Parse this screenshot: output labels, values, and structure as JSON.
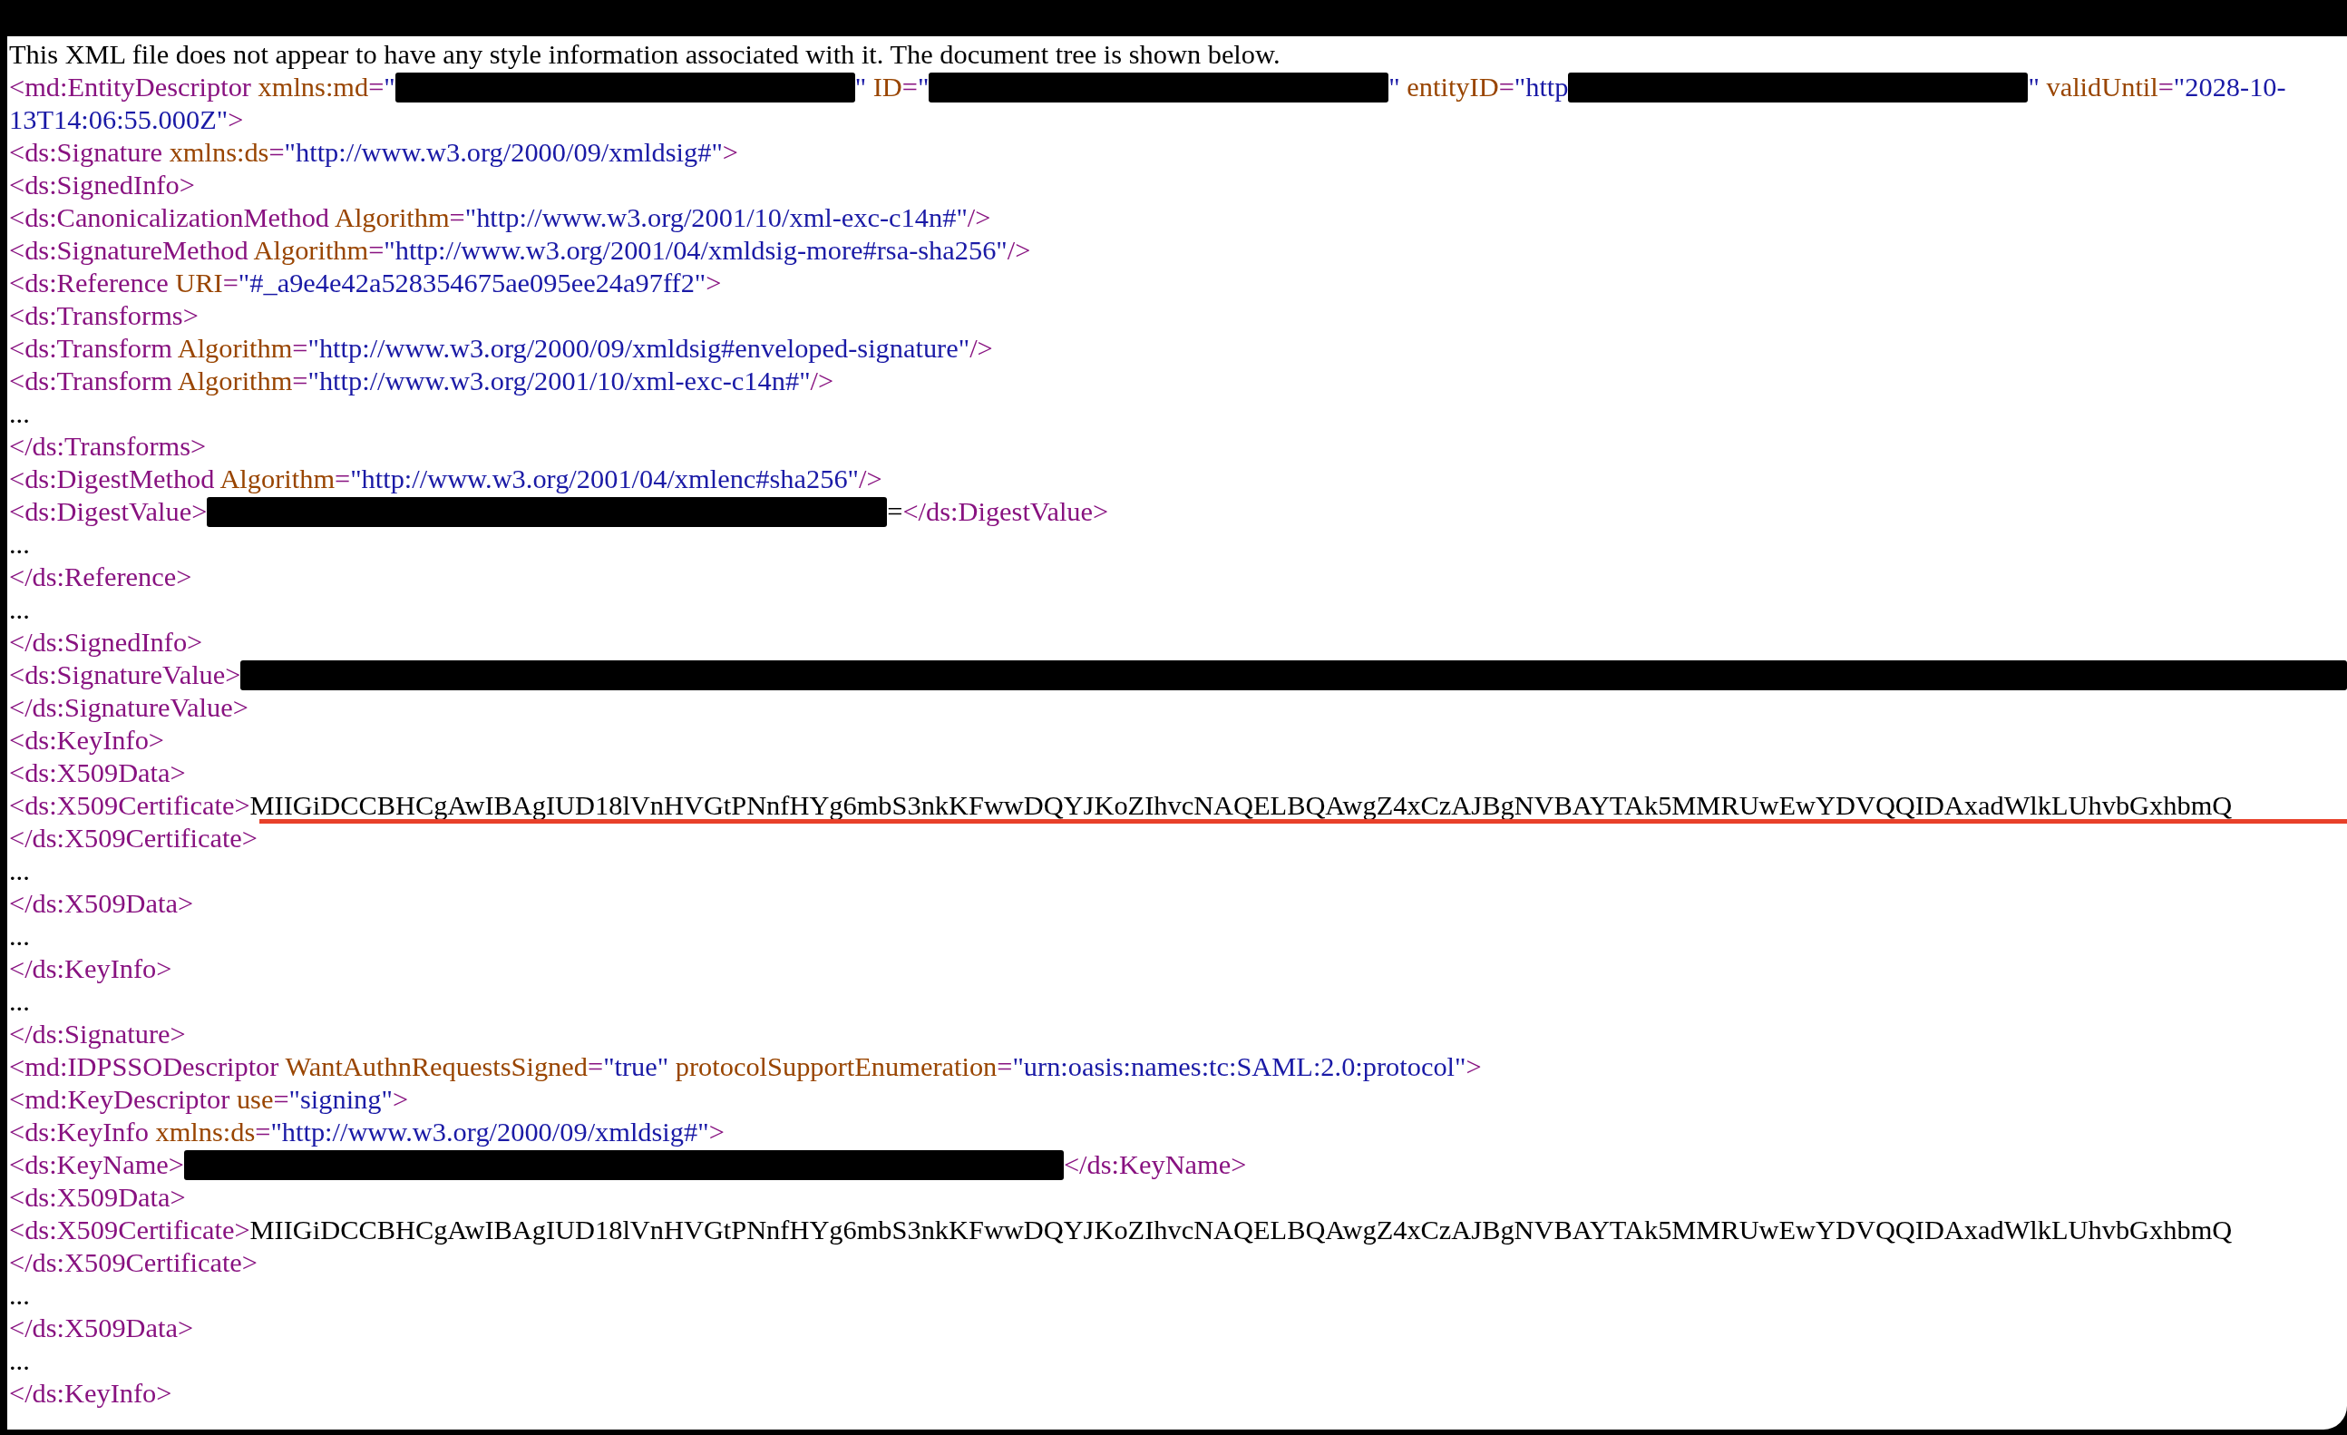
{
  "lines": [
    {
      "underlined": false,
      "segments": [
        {
          "kind": "code",
          "tokens": [
            {
              "kind": "text",
              "text": "This XML file does not appear to have any style information associated with it. The document tree is shown below."
            }
          ]
        }
      ]
    },
    {
      "underlined": false,
      "segments": [
        {
          "kind": "code",
          "tokens": [
            {
              "kind": "tag",
              "text": "<md:EntityDescriptor"
            },
            {
              "kind": "attr",
              "text": " xmlns:md"
            },
            {
              "kind": "tag",
              "text": "="
            },
            {
              "kind": "value",
              "text": "\""
            }
          ]
        },
        {
          "kind": "redacted"
        },
        {
          "kind": "code",
          "tokens": [
            {
              "kind": "value",
              "text": "\""
            },
            {
              "kind": "attr",
              "text": " ID"
            },
            {
              "kind": "tag",
              "text": "="
            },
            {
              "kind": "value",
              "text": "\""
            }
          ]
        },
        {
          "kind": "redacted"
        },
        {
          "kind": "code",
          "tokens": [
            {
              "kind": "value",
              "text": "\""
            },
            {
              "kind": "attr",
              "text": " entityID"
            },
            {
              "kind": "tag",
              "text": "="
            },
            {
              "kind": "value",
              "text": "\"http"
            }
          ]
        },
        {
          "kind": "redacted"
        },
        {
          "kind": "code",
          "tokens": [
            {
              "kind": "value",
              "text": "\""
            },
            {
              "kind": "attr",
              "text": " validUntil"
            },
            {
              "kind": "tag",
              "text": "="
            },
            {
              "kind": "value",
              "text": "\"2028-10-"
            }
          ]
        }
      ]
    },
    {
      "underlined": false,
      "segments": [
        {
          "kind": "code",
          "tokens": [
            {
              "kind": "value",
              "text": "13T14:06:55.000Z\""
            },
            {
              "kind": "tag",
              "text": ">"
            }
          ]
        }
      ]
    },
    {
      "underlined": false,
      "segments": [
        {
          "kind": "code",
          "tokens": [
            {
              "kind": "tag",
              "text": "<ds:Signature"
            },
            {
              "kind": "attr",
              "text": " xmlns:ds"
            },
            {
              "kind": "tag",
              "text": "="
            },
            {
              "kind": "value",
              "text": "\"http://www.w3.org/2000/09/xmldsig#\""
            },
            {
              "kind": "tag",
              "text": ">"
            }
          ]
        }
      ]
    },
    {
      "underlined": false,
      "segments": [
        {
          "kind": "code",
          "tokens": [
            {
              "kind": "tag",
              "text": "<ds:SignedInfo>"
            }
          ]
        }
      ]
    },
    {
      "underlined": false,
      "segments": [
        {
          "kind": "code",
          "tokens": [
            {
              "kind": "tag",
              "text": "<ds:CanonicalizationMethod"
            },
            {
              "kind": "attr",
              "text": " Algorithm"
            },
            {
              "kind": "tag",
              "text": "="
            },
            {
              "kind": "value",
              "text": "\"http://www.w3.org/2001/10/xml-exc-c14n#\""
            },
            {
              "kind": "tag",
              "text": "/>"
            }
          ]
        }
      ]
    },
    {
      "underlined": false,
      "segments": [
        {
          "kind": "code",
          "tokens": [
            {
              "kind": "tag",
              "text": "<ds:SignatureMethod"
            },
            {
              "kind": "attr",
              "text": " Algorithm"
            },
            {
              "kind": "tag",
              "text": "="
            },
            {
              "kind": "value",
              "text": "\"http://www.w3.org/2001/04/xmldsig-more#rsa-sha256\""
            },
            {
              "kind": "tag",
              "text": "/>"
            }
          ]
        }
      ]
    },
    {
      "underlined": false,
      "segments": [
        {
          "kind": "code",
          "tokens": [
            {
              "kind": "tag",
              "text": "<ds:Reference"
            },
            {
              "kind": "attr",
              "text": " URI"
            },
            {
              "kind": "tag",
              "text": "="
            },
            {
              "kind": "value",
              "text": "\"#_a9e4e42a528354675ae095ee24a97ff2\""
            },
            {
              "kind": "tag",
              "text": ">"
            }
          ]
        }
      ]
    },
    {
      "underlined": false,
      "segments": [
        {
          "kind": "code",
          "tokens": [
            {
              "kind": "tag",
              "text": "<ds:Transforms>"
            }
          ]
        }
      ]
    },
    {
      "underlined": false,
      "segments": [
        {
          "kind": "code",
          "tokens": [
            {
              "kind": "tag",
              "text": "<ds:Transform"
            },
            {
              "kind": "attr",
              "text": " Algorithm"
            },
            {
              "kind": "tag",
              "text": "="
            },
            {
              "kind": "value",
              "text": "\"http://www.w3.org/2000/09/xmldsig#enveloped-signature\""
            },
            {
              "kind": "tag",
              "text": "/>"
            }
          ]
        }
      ]
    },
    {
      "underlined": false,
      "segments": [
        {
          "kind": "code",
          "tokens": [
            {
              "kind": "tag",
              "text": "<ds:Transform"
            },
            {
              "kind": "attr",
              "text": " Algorithm"
            },
            {
              "kind": "tag",
              "text": "="
            },
            {
              "kind": "value",
              "text": "\"http://www.w3.org/2001/10/xml-exc-c14n#\""
            },
            {
              "kind": "tag",
              "text": "/>"
            }
          ]
        }
      ]
    },
    {
      "underlined": false,
      "segments": [
        {
          "kind": "code",
          "tokens": [
            {
              "kind": "text",
              "text": "..."
            }
          ]
        }
      ]
    },
    {
      "underlined": false,
      "segments": [
        {
          "kind": "code",
          "tokens": [
            {
              "kind": "tag",
              "text": "</ds:Transforms>"
            }
          ]
        }
      ]
    },
    {
      "underlined": false,
      "segments": [
        {
          "kind": "code",
          "tokens": [
            {
              "kind": "tag",
              "text": "<ds:DigestMethod"
            },
            {
              "kind": "attr",
              "text": " Algorithm"
            },
            {
              "kind": "tag",
              "text": "="
            },
            {
              "kind": "value",
              "text": "\"http://www.w3.org/2001/04/xmlenc#sha256\""
            },
            {
              "kind": "tag",
              "text": "/>"
            }
          ]
        }
      ]
    },
    {
      "underlined": false,
      "segments": [
        {
          "kind": "code",
          "tokens": [
            {
              "kind": "tag",
              "text": "<ds:DigestValue>"
            }
          ]
        },
        {
          "kind": "redacted"
        },
        {
          "kind": "code",
          "tokens": [
            {
              "kind": "text",
              "text": "="
            },
            {
              "kind": "tag",
              "text": "</ds:DigestValue>"
            }
          ]
        }
      ]
    },
    {
      "underlined": false,
      "segments": [
        {
          "kind": "code",
          "tokens": [
            {
              "kind": "text",
              "text": "..."
            }
          ]
        }
      ]
    },
    {
      "underlined": false,
      "segments": [
        {
          "kind": "code",
          "tokens": [
            {
              "kind": "tag",
              "text": "</ds:Reference>"
            }
          ]
        }
      ]
    },
    {
      "underlined": false,
      "segments": [
        {
          "kind": "code",
          "tokens": [
            {
              "kind": "text",
              "text": "..."
            }
          ]
        }
      ]
    },
    {
      "underlined": false,
      "segments": [
        {
          "kind": "code",
          "tokens": [
            {
              "kind": "tag",
              "text": "</ds:SignedInfo>"
            }
          ]
        }
      ]
    },
    {
      "underlined": false,
      "segments": [
        {
          "kind": "code",
          "tokens": [
            {
              "kind": "tag",
              "text": "<ds:SignatureValue>"
            }
          ]
        },
        {
          "kind": "redacted"
        }
      ]
    },
    {
      "underlined": false,
      "segments": [
        {
          "kind": "code",
          "tokens": [
            {
              "kind": "tag",
              "text": "</ds:SignatureValue>"
            }
          ]
        }
      ]
    },
    {
      "underlined": false,
      "segments": [
        {
          "kind": "code",
          "tokens": [
            {
              "kind": "tag",
              "text": "<ds:KeyInfo>"
            }
          ]
        }
      ]
    },
    {
      "underlined": false,
      "segments": [
        {
          "kind": "code",
          "tokens": [
            {
              "kind": "tag",
              "text": "<ds:X509Data>"
            }
          ]
        }
      ]
    },
    {
      "underlined": true,
      "segments": [
        {
          "kind": "code",
          "tokens": [
            {
              "kind": "tag",
              "text": "<ds:X509Certificate>"
            }
          ]
        },
        {
          "kind": "code",
          "tokens": [
            {
              "kind": "text",
              "text": "MIIGiDCCBHCgAwIBAgIUD18lVnHVGtPNnfHYg6mbS3nkKFwwDQYJKoZIhvcNAQELBQAwgZ4xCzAJBgNVBAYTAk5MMRUwEwYDVQQIDAxadWlkLUhvbGxhbmQ"
            }
          ]
        }
      ]
    },
    {
      "underlined": false,
      "segments": [
        {
          "kind": "code",
          "tokens": [
            {
              "kind": "tag",
              "text": "</ds:X509Certificate>"
            }
          ]
        }
      ]
    },
    {
      "underlined": false,
      "segments": [
        {
          "kind": "code",
          "tokens": [
            {
              "kind": "text",
              "text": "..."
            }
          ]
        }
      ]
    },
    {
      "underlined": false,
      "segments": [
        {
          "kind": "code",
          "tokens": [
            {
              "kind": "tag",
              "text": "</ds:X509Data>"
            }
          ]
        }
      ]
    },
    {
      "underlined": false,
      "segments": [
        {
          "kind": "code",
          "tokens": [
            {
              "kind": "text",
              "text": "..."
            }
          ]
        }
      ]
    },
    {
      "underlined": false,
      "segments": [
        {
          "kind": "code",
          "tokens": [
            {
              "kind": "tag",
              "text": "</ds:KeyInfo>"
            }
          ]
        }
      ]
    },
    {
      "underlined": false,
      "segments": [
        {
          "kind": "code",
          "tokens": [
            {
              "kind": "text",
              "text": "..."
            }
          ]
        }
      ]
    },
    {
      "underlined": false,
      "segments": [
        {
          "kind": "code",
          "tokens": [
            {
              "kind": "tag",
              "text": "</ds:Signature>"
            }
          ]
        }
      ]
    },
    {
      "underlined": false,
      "segments": [
        {
          "kind": "code",
          "tokens": [
            {
              "kind": "tag",
              "text": "<md:IDPSSODescriptor"
            },
            {
              "kind": "attr",
              "text": " WantAuthnRequestsSigned"
            },
            {
              "kind": "tag",
              "text": "="
            },
            {
              "kind": "value",
              "text": "\"true\""
            },
            {
              "kind": "attr",
              "text": " protocolSupportEnumeration"
            },
            {
              "kind": "tag",
              "text": "="
            },
            {
              "kind": "value",
              "text": "\"urn:oasis:names:tc:SAML:2.0:protocol\""
            },
            {
              "kind": "tag",
              "text": ">"
            }
          ]
        }
      ]
    },
    {
      "underlined": false,
      "segments": [
        {
          "kind": "code",
          "tokens": [
            {
              "kind": "tag",
              "text": "<md:KeyDescriptor"
            },
            {
              "kind": "attr",
              "text": " use"
            },
            {
              "kind": "tag",
              "text": "="
            },
            {
              "kind": "value",
              "text": "\"signing\""
            },
            {
              "kind": "tag",
              "text": ">"
            }
          ]
        }
      ]
    },
    {
      "underlined": false,
      "segments": [
        {
          "kind": "code",
          "tokens": [
            {
              "kind": "tag",
              "text": "<ds:KeyInfo"
            },
            {
              "kind": "attr",
              "text": " xmlns:ds"
            },
            {
              "kind": "tag",
              "text": "="
            },
            {
              "kind": "value",
              "text": "\"http://www.w3.org/2000/09/xmldsig#\""
            },
            {
              "kind": "tag",
              "text": ">"
            }
          ]
        }
      ]
    },
    {
      "underlined": false,
      "segments": [
        {
          "kind": "code",
          "tokens": [
            {
              "kind": "tag",
              "text": "<ds:KeyName>"
            }
          ]
        },
        {
          "kind": "redacted"
        },
        {
          "kind": "code",
          "tokens": [
            {
              "kind": "tag",
              "text": "</ds:KeyName>"
            }
          ]
        }
      ]
    },
    {
      "underlined": false,
      "segments": [
        {
          "kind": "code",
          "tokens": [
            {
              "kind": "tag",
              "text": "<ds:X509Data>"
            }
          ]
        }
      ]
    },
    {
      "underlined": false,
      "segments": [
        {
          "kind": "code",
          "tokens": [
            {
              "kind": "tag",
              "text": "<ds:X509Certificate>"
            }
          ]
        },
        {
          "kind": "code",
          "tokens": [
            {
              "kind": "text",
              "text": "MIIGiDCCBHCgAwIBAgIUD18lVnHVGtPNnfHYg6mbS3nkKFwwDQYJKoZIhvcNAQELBQAwgZ4xCzAJBgNVBAYTAk5MMRUwEwYDVQQIDAxadWlkLUhvbGxhbmQ"
            }
          ]
        }
      ]
    },
    {
      "underlined": false,
      "segments": [
        {
          "kind": "code",
          "tokens": [
            {
              "kind": "tag",
              "text": "</ds:X509Certificate>"
            }
          ]
        }
      ]
    },
    {
      "underlined": false,
      "segments": [
        {
          "kind": "code",
          "tokens": [
            {
              "kind": "text",
              "text": "..."
            }
          ]
        }
      ]
    },
    {
      "underlined": false,
      "segments": [
        {
          "kind": "code",
          "tokens": [
            {
              "kind": "tag",
              "text": "</ds:X509Data>"
            }
          ]
        }
      ]
    },
    {
      "underlined": false,
      "segments": [
        {
          "kind": "code",
          "tokens": [
            {
              "kind": "text",
              "text": "..."
            }
          ]
        }
      ]
    },
    {
      "underlined": false,
      "segments": [
        {
          "kind": "code",
          "tokens": [
            {
              "kind": "tag",
              "text": "</ds:KeyInfo>"
            }
          ]
        }
      ]
    }
  ]
}
